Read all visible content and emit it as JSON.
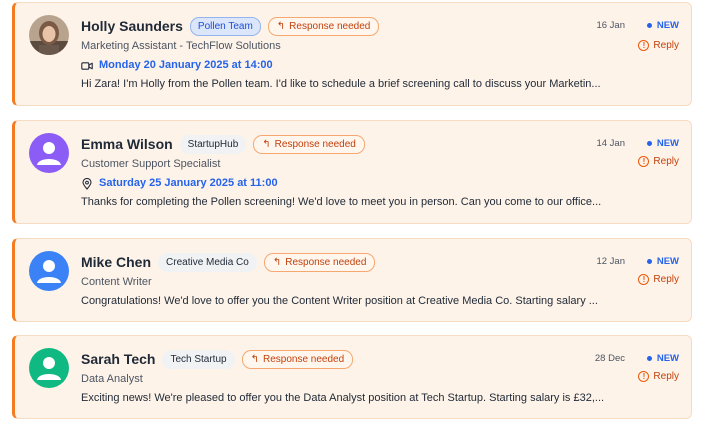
{
  "messages": [
    {
      "name": "Holly Saunders",
      "company": "Pollen Team",
      "needed": "Response needed",
      "role": "Marketing Assistant - TechFlow Solutions",
      "event_icon": "video-camera-icon",
      "event": "Monday 20 January 2025 at 14:00",
      "message": "Hi Zara! I'm Holly from the Pollen team. I'd like to schedule a brief screening call to discuss your Marketin...",
      "date": "16 Jan",
      "status": "NEW",
      "reply": "Reply",
      "avatar": "photo"
    },
    {
      "name": "Emma Wilson",
      "company": "StartupHub",
      "needed": "Response needed",
      "role": "Customer Support Specialist",
      "event_icon": "location-pin-icon",
      "event": "Saturday 25 January 2025 at 11:00",
      "message": "Thanks for completing the Pollen screening! We'd love to meet you in person. Can you come to our office...",
      "date": "14 Jan",
      "status": "NEW",
      "reply": "Reply",
      "avatar_color": "#8b5cf6"
    },
    {
      "name": "Mike Chen",
      "company": "Creative Media Co",
      "needed": "Response needed",
      "role": "Content Writer",
      "message": "Congratulations! We'd love to offer you the Content Writer position at Creative Media Co. Starting salary ...",
      "date": "12 Jan",
      "status": "NEW",
      "reply": "Reply",
      "avatar_color": "#3b82f6"
    },
    {
      "name": "Sarah Tech",
      "company": "Tech Startup",
      "needed": "Response needed",
      "role": "Data Analyst",
      "message": "Exciting news! We're pleased to offer you the Data Analyst position at Tech Startup. Starting salary is £32,...",
      "date": "28 Dec",
      "status": "NEW",
      "reply": "Reply",
      "avatar_color": "#10b981"
    }
  ],
  "colors": {
    "accent": "#f47b20",
    "card_bg": "#fef3e8",
    "link_blue": "#2563eb",
    "reply_orange": "#c2410c"
  }
}
